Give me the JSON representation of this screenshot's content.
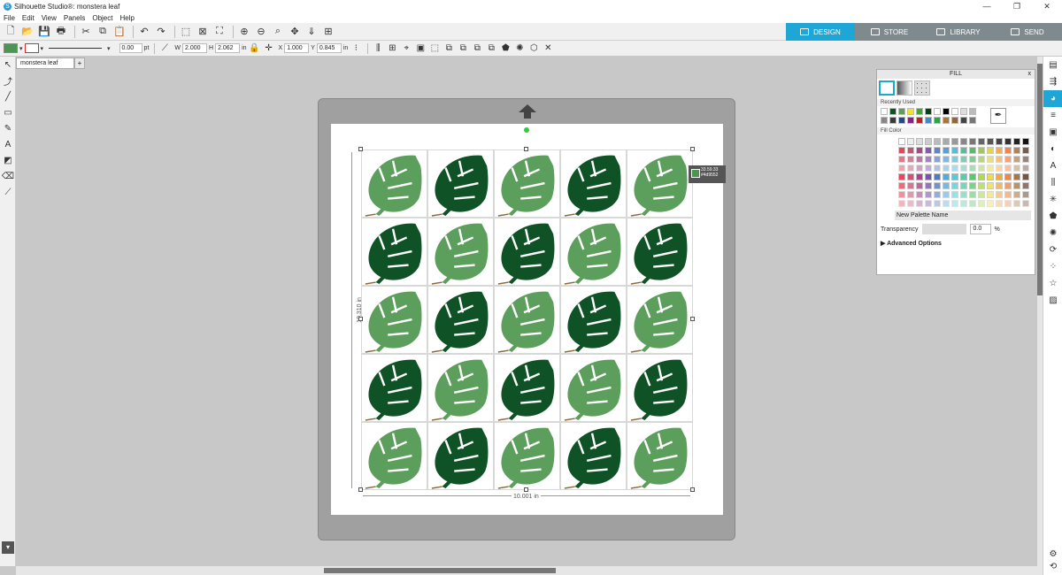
{
  "window": {
    "title": "Silhouette Studio®: monstera leaf",
    "minimize": "—",
    "restore": "❐",
    "close": "✕"
  },
  "menu": [
    "File",
    "Edit",
    "View",
    "Panels",
    "Object",
    "Help"
  ],
  "tabs": [
    {
      "label": "DESIGN",
      "active": true
    },
    {
      "label": "STORE",
      "active": false
    },
    {
      "label": "LIBRARY",
      "active": false
    },
    {
      "label": "SEND",
      "active": false
    }
  ],
  "toolbar2": {
    "fill_color": "#4d9552",
    "line_color": "#d32f2f",
    "line_width": "0.00",
    "line_unit": "pt",
    "w_label": "W",
    "w_value": "2.000",
    "h_label": "H",
    "h_value": "2.062",
    "size_unit": "in",
    "x_label": "X",
    "x_value": "1.000",
    "y_label": "Y",
    "y_value": "0.845",
    "pos_unit": "in"
  },
  "doc_tab": "monstera leaf",
  "doc_tab_add": "+",
  "canvas": {
    "height_dim": "10.310 in",
    "width_dim": "10.001 in",
    "tooltip_line1": "33.59.33",
    "tooltip_line2": "#4d9552",
    "leaf_light": "#5c9e5c",
    "leaf_dark": "#0e5226",
    "leaf_grid": [
      [
        "light",
        "dark",
        "light",
        "dark",
        "light"
      ],
      [
        "dark",
        "light",
        "dark",
        "light",
        "dark"
      ],
      [
        "light",
        "dark",
        "light",
        "dark",
        "light"
      ],
      [
        "dark",
        "light",
        "dark",
        "light",
        "dark"
      ],
      [
        "light",
        "dark",
        "light",
        "dark",
        "light"
      ]
    ]
  },
  "fill_panel": {
    "title": "FILL",
    "close": "x",
    "recently_used": "Recently Used",
    "fill_color": "Fill Color",
    "new_palette": "New Palette Name",
    "add": "+",
    "transparency_label": "Transparency",
    "transparency_value": "0.0",
    "transparency_unit": "%",
    "advanced": "Advanced Options",
    "recent_colors": [
      "#ffffff",
      "#0e5226",
      "#5c9e5c",
      "#f2e22a",
      "#3ea52e",
      "#0b3d1a",
      "#ffffff",
      "#000000",
      "#ffffff",
      "#dddddd",
      "#bbbbbb",
      "#888888",
      "#3a3a3a",
      "#1e4a8a",
      "#8a1e8a",
      "#bb2222",
      "#4488cc",
      "#22aa44",
      "#aa7733",
      "#996633",
      "#444444",
      "#777777"
    ],
    "palette_colors": [
      "#cc2233",
      "#aa3355",
      "#882266",
      "#663399",
      "#4466aa",
      "#3388cc",
      "#33aacc",
      "#33aa88",
      "#33aa44",
      "#88bb33",
      "#ddcc22",
      "#ee9922",
      "#ee6622",
      "#996633",
      "#553322",
      "#ee4455",
      "#cc5577",
      "#aa4488",
      "#7755aa",
      "#5577bb",
      "#55aadd",
      "#55ccdd",
      "#55ccaa",
      "#55cc66",
      "#aadd55",
      "#eedd44",
      "#eeaa44",
      "#ee8844",
      "#aa7744",
      "#775544"
    ]
  }
}
